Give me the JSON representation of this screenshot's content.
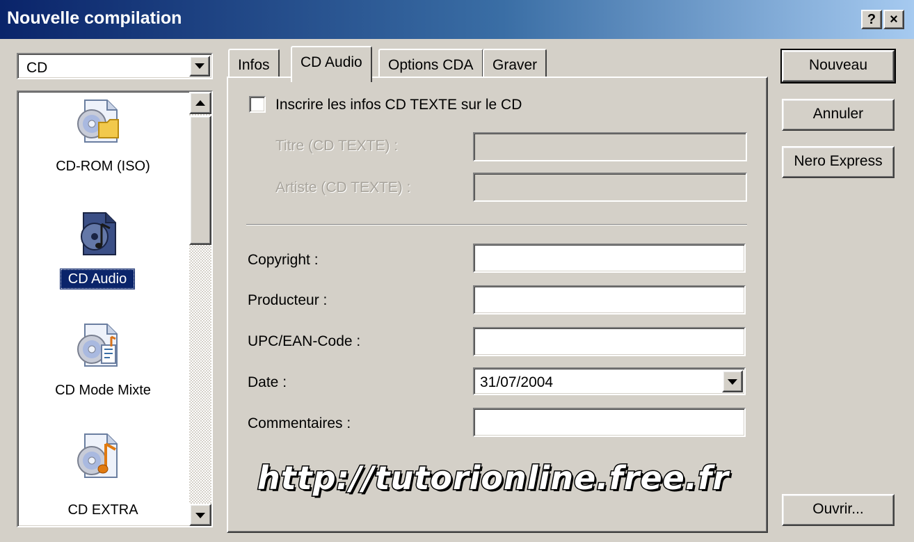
{
  "window": {
    "title": "Nouvelle compilation",
    "help_label": "?",
    "close_label": "×"
  },
  "left": {
    "combo_value": "CD",
    "items": [
      {
        "label": "CD-ROM (ISO)",
        "icon": "cd-rom-iso-icon"
      },
      {
        "label": "CD Audio",
        "icon": "cd-audio-icon",
        "selected": true
      },
      {
        "label": "CD Mode Mixte",
        "icon": "cd-mixed-mode-icon"
      },
      {
        "label": "CD EXTRA",
        "icon": "cd-extra-icon"
      }
    ]
  },
  "tabs": [
    {
      "label": "Infos"
    },
    {
      "label": "CD Audio",
      "active": true
    },
    {
      "label": "Options CDA"
    },
    {
      "label": "Graver"
    }
  ],
  "form": {
    "cdtext_checkbox_label": "Inscrire les infos CD TEXTE sur le CD",
    "cdtext_checked": false,
    "titre_label": "Titre (CD TEXTE) :",
    "artiste_label": "Artiste (CD TEXTE) :",
    "copyright_label": "Copyright :",
    "producteur_label": "Producteur :",
    "upc_label": "UPC/EAN-Code :",
    "date_label": "Date :",
    "date_value": "31/07/2004",
    "commentaires_label": "Commentaires :"
  },
  "buttons": {
    "nouveau": "Nouveau",
    "annuler": "Annuler",
    "nero_express": "Nero Express",
    "ouvrir": "Ouvrir..."
  },
  "watermark": "http://tutorionline.free.fr",
  "colors": {
    "titlebar_start": "#0a246a",
    "titlebar_end": "#a6caf0",
    "face": "#d4d0c8",
    "selection": "#0a246a"
  }
}
